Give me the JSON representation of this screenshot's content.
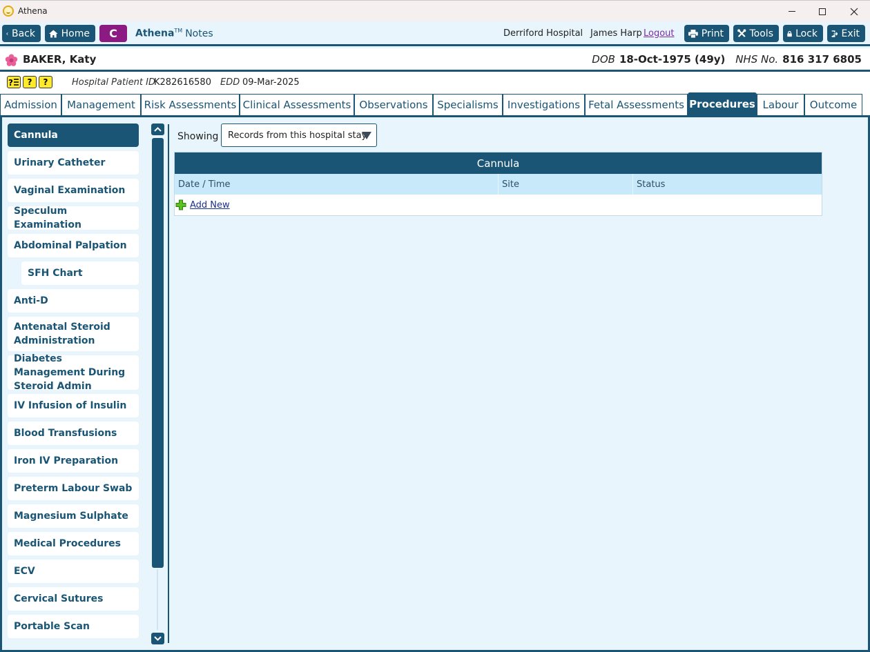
{
  "window": {
    "title": "Athena"
  },
  "toolbar": {
    "back": "Back",
    "home": "Home",
    "c_button": "C",
    "brand": "Athena",
    "brand_mark": "TM",
    "module": "Notes",
    "hospital": "Derriford Hospital",
    "user": "James Harp",
    "logout": "Logout",
    "print": "Print",
    "tools": "Tools",
    "lock": "Lock",
    "exit": "Exit"
  },
  "patient": {
    "surname": "BAKER,",
    "forename": "Katy",
    "dob_label": "DOB",
    "dob": "18-Oct-1975 (49y)",
    "nhs_label": "NHS No.",
    "nhs": "816 317 6805"
  },
  "info": {
    "alerts": [
      "?",
      "?"
    ],
    "hospital_id_label": "Hospital Patient ID",
    "hospital_id": "K282616580",
    "edd_label": "EDD",
    "edd": "09-Mar-2025"
  },
  "tabs": [
    "Admission",
    "Management",
    "Risk Assessments",
    "Clinical Assessments",
    "Observations",
    "Specialisms",
    "Investigations",
    "Fetal Assessments",
    "Procedures",
    "Labour",
    "Outcome"
  ],
  "active_tab": "Procedures",
  "sidebar": {
    "items": [
      "Cannula",
      "Urinary Catheter",
      "Vaginal Examination",
      "Speculum Examination",
      "Abdominal Palpation",
      "SFH Chart",
      "Anti-D",
      "Antenatal Steroid Administration",
      "Diabetes Management During Steroid Admin",
      "IV Infusion of Insulin",
      "Blood Transfusions",
      "Iron IV Preparation",
      "Preterm Labour Swab",
      "Magnesium Sulphate",
      "Medical Procedures",
      "ECV",
      "Cervical Sutures",
      "Portable Scan"
    ],
    "active": "Cannula"
  },
  "filter": {
    "label": "Showing",
    "selected": "Records from this hospital stay"
  },
  "panel": {
    "title": "Cannula",
    "columns": [
      "Date / Time",
      "Site",
      "Status"
    ],
    "add_new": "Add New"
  },
  "colors": {
    "primary": "#1a5575",
    "accent": "#8b1a82",
    "header_bg": "#c8e9fa",
    "page_bg": "#e8f5fc"
  }
}
